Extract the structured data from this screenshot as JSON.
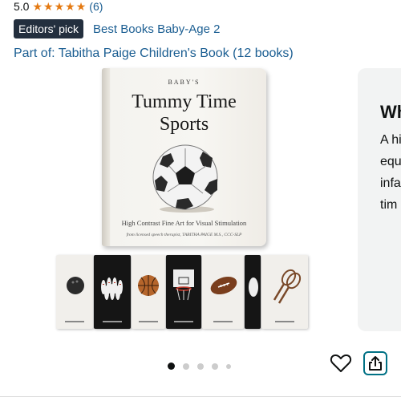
{
  "rating": {
    "value": "5.0",
    "stars": 5,
    "count": "(6)"
  },
  "badge": {
    "label": "Editors' pick",
    "link": "Best Books Baby-Age 2"
  },
  "series": {
    "link": "Part of: Tabitha Paige Children's Book (12 books)"
  },
  "book_cover": {
    "small_caption": "BABY'S",
    "title_line1": "Tummy Time",
    "title_line2": "Sports",
    "subtitle": "High Contrast Fine Art for Visual Stimulation",
    "author": "from licensed speech therapist, TABITHA PAIGE M.S., CCC-SLP"
  },
  "right_card": {
    "heading": "Wh",
    "lines": [
      "A hi",
      "equ",
      "infa",
      "tim"
    ]
  },
  "carousel": {
    "total_dots": 5,
    "active_index": 0
  },
  "colors": {
    "star": "#e47911",
    "link": "#1b5e92",
    "badge_bg": "#232f3e",
    "share_border": "#007185"
  },
  "icons": {
    "wishlist": "heart-outline-icon",
    "share": "share-icon"
  }
}
